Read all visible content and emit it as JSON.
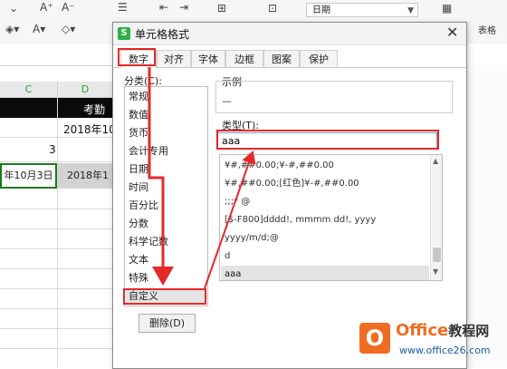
{
  "ribbon": {
    "date_format": "日期",
    "table_style_label": "表格"
  },
  "sheet": {
    "columns": [
      "C",
      "D"
    ],
    "title_cell": "考勤",
    "date_header": "2018年10",
    "number_cell": "3",
    "date_cell_left": "年10月3日",
    "date_cell_right": "2018年1"
  },
  "dialog": {
    "title": "单元格格式",
    "tabs": [
      "数字",
      "对齐",
      "字体",
      "边框",
      "图案",
      "保护"
    ],
    "category_label": "分类(C):",
    "categories": [
      "常规",
      "数值",
      "货币",
      "会计专用",
      "日期",
      "时间",
      "百分比",
      "分数",
      "科学记数",
      "文本",
      "特殊",
      "自定义"
    ],
    "selected_category": "自定义",
    "sample_label": "示例",
    "sample_value": "—",
    "type_label": "类型(T):",
    "type_value": "aaa",
    "format_list": [
      "¥#,##0.00;¥-#,##0.00",
      "¥#,##0.00;[红色]¥-#,##0.00",
      ";;;* @",
      "[$-F800]dddd!, mmmm dd!, yyyy",
      "yyyy/m/d;@",
      "d",
      "aaa"
    ],
    "selected_format": "aaa",
    "delete_button": "删除(D)"
  },
  "watermark": {
    "logo_letter": "O",
    "brand_en": "Office",
    "brand_zh": "教程网",
    "url": "www.office26.com"
  },
  "colors": {
    "annotation_red": "#e4282a",
    "brand_orange": "#ef6d22",
    "app_green": "#2eb14a"
  }
}
